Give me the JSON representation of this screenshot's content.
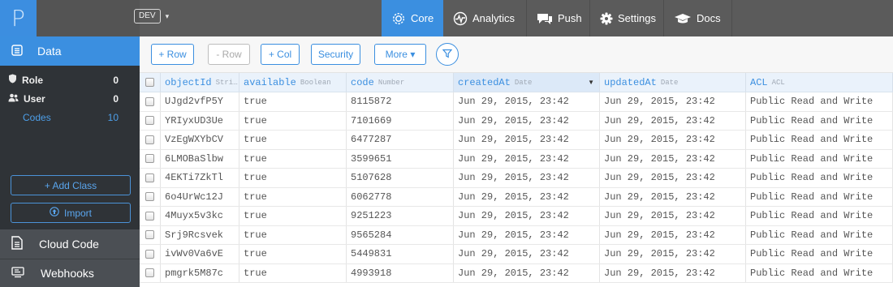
{
  "logo": {
    "glyph": "P"
  },
  "environment": {
    "label": "DEV",
    "caret": "▾"
  },
  "top_nav": [
    {
      "label": "Core",
      "icon": "core-gear-icon",
      "active": true
    },
    {
      "label": "Analytics",
      "icon": "analytics-pulse-icon",
      "active": false
    },
    {
      "label": "Push",
      "icon": "push-speech-icon",
      "active": false
    },
    {
      "label": "Settings",
      "icon": "settings-gear-icon",
      "active": false
    },
    {
      "label": "Docs",
      "icon": "docs-cap-icon",
      "active": false
    }
  ],
  "sidebar": {
    "data_label": "Data",
    "classes": [
      {
        "name": "Role",
        "count": "0",
        "icon": "shield-icon"
      },
      {
        "name": "User",
        "count": "0",
        "icon": "users-icon"
      },
      {
        "name": "Codes",
        "count": "10",
        "selected": true
      }
    ],
    "add_class_label": "+  Add Class",
    "import_label": "Import",
    "cloud_code_label": "Cloud Code",
    "webhooks_label": "Webhooks"
  },
  "toolbar": {
    "add_row": "+ Row",
    "remove_row": "- Row",
    "add_col": "+ Col",
    "security": "Security",
    "more": "More ▾"
  },
  "table": {
    "columns": [
      {
        "name": "objectId",
        "type": "Stri…"
      },
      {
        "name": "available",
        "type": "Boolean"
      },
      {
        "name": "code",
        "type": "Number"
      },
      {
        "name": "createdAt",
        "type": "Date",
        "sorted": true,
        "sort_caret": "▼"
      },
      {
        "name": "updatedAt",
        "type": "Date"
      },
      {
        "name": "ACL",
        "type": "ACL"
      }
    ],
    "rows": [
      [
        "UJgd2vfP5Y",
        "true",
        "8115872",
        "Jun 29, 2015, 23:42",
        "Jun 29, 2015, 23:42",
        "Public Read and Write"
      ],
      [
        "YRIyxUD3Ue",
        "true",
        "7101669",
        "Jun 29, 2015, 23:42",
        "Jun 29, 2015, 23:42",
        "Public Read and Write"
      ],
      [
        "VzEgWXYbCV",
        "true",
        "6477287",
        "Jun 29, 2015, 23:42",
        "Jun 29, 2015, 23:42",
        "Public Read and Write"
      ],
      [
        "6LMOBaSlbw",
        "true",
        "3599651",
        "Jun 29, 2015, 23:42",
        "Jun 29, 2015, 23:42",
        "Public Read and Write"
      ],
      [
        "4EKTi7ZkTl",
        "true",
        "5107628",
        "Jun 29, 2015, 23:42",
        "Jun 29, 2015, 23:42",
        "Public Read and Write"
      ],
      [
        "6o4UrWc12J",
        "true",
        "6062778",
        "Jun 29, 2015, 23:42",
        "Jun 29, 2015, 23:42",
        "Public Read and Write"
      ],
      [
        "4Muyx5v3kc",
        "true",
        "9251223",
        "Jun 29, 2015, 23:42",
        "Jun 29, 2015, 23:42",
        "Public Read and Write"
      ],
      [
        "Srj9Rcsvek",
        "true",
        "9565284",
        "Jun 29, 2015, 23:42",
        "Jun 29, 2015, 23:42",
        "Public Read and Write"
      ],
      [
        "ivWv0Va6vE",
        "true",
        "5449831",
        "Jun 29, 2015, 23:42",
        "Jun 29, 2015, 23:42",
        "Public Read and Write"
      ],
      [
        "pmgrk5M87c",
        "true",
        "4993918",
        "Jun 29, 2015, 23:42",
        "Jun 29, 2015, 23:42",
        "Public Read and Write"
      ]
    ]
  },
  "colors": {
    "accent": "#3b8fe0",
    "topbar": "#5b5b5b",
    "sidebar": "#2f3337",
    "sidebar_section": "#4b4f54",
    "header_bg": "#eaf2fb"
  }
}
